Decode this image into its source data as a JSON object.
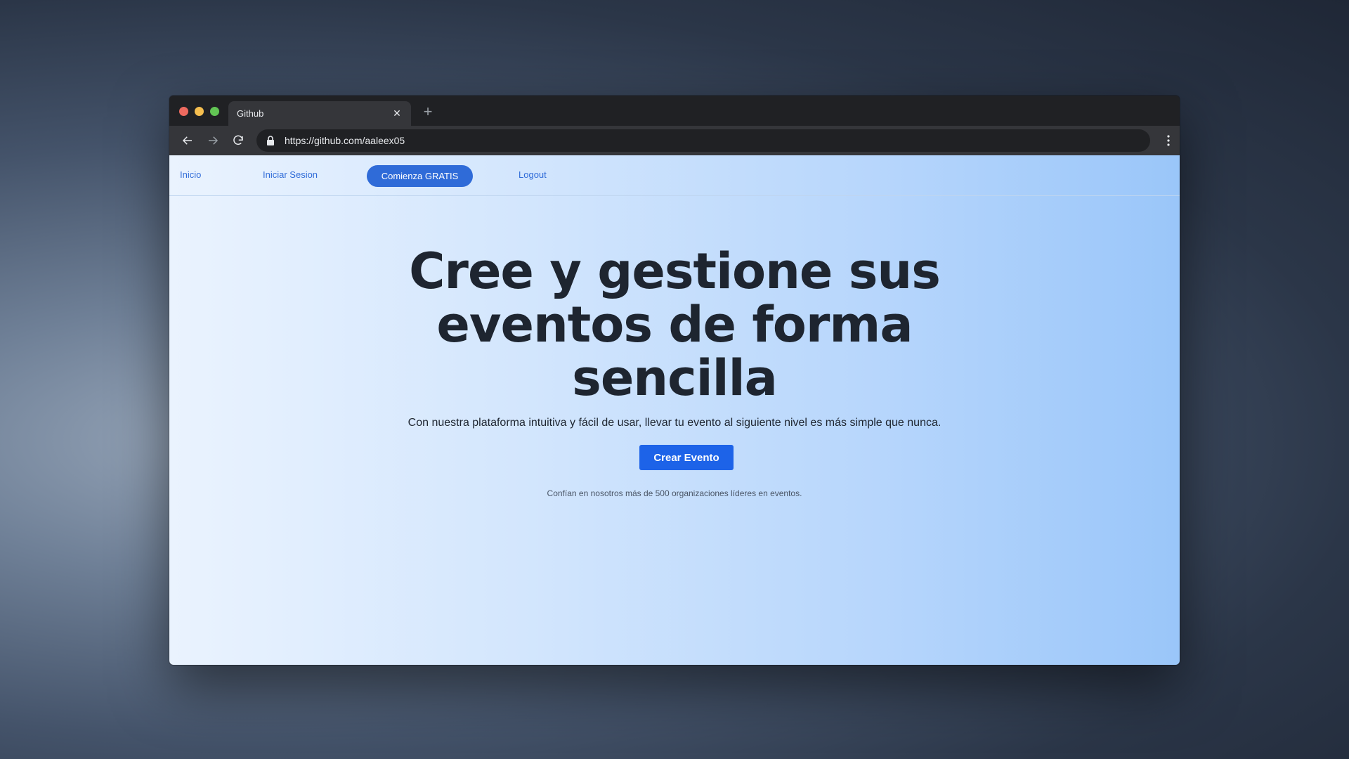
{
  "browser": {
    "tab_title": "Github",
    "url": "https://github.com/aaleex05",
    "new_tab_symbol": "+",
    "close_symbol": "✕"
  },
  "navbar": {
    "links": [
      {
        "label": "Inicio"
      },
      {
        "label": "Iniciar Sesion"
      },
      {
        "label": "Comienza GRATIS"
      },
      {
        "label": "Logout"
      }
    ]
  },
  "hero": {
    "title_lines": [
      "Cree y gestione sus",
      "eventos de forma",
      "sencilla"
    ],
    "subtitle": "Con nuestra plataforma intuitiva y fácil de usar, llevar tu evento al siguiente nivel es más simple que nunca.",
    "cta_label": "Crear Evento",
    "trust_text": "Confían en nosotros más de 500 organizaciones líderes en eventos."
  },
  "colors": {
    "accent": "#2f6bd8",
    "cta": "#1d63e8",
    "heading": "#1e2530"
  }
}
